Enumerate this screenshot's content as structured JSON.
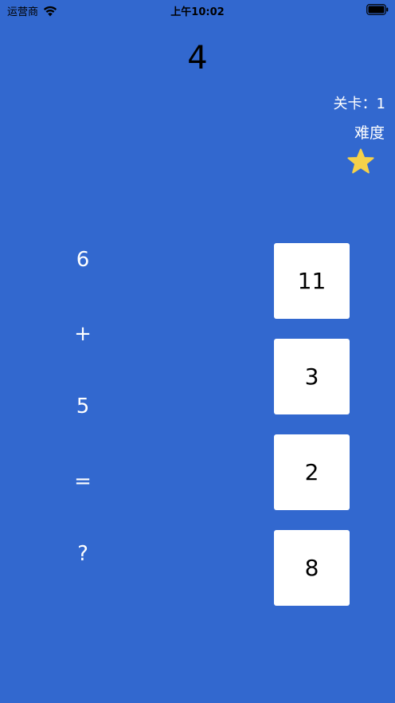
{
  "status_bar": {
    "carrier": "运营商",
    "time": "上午10:02"
  },
  "game": {
    "score": "4",
    "level_text": "关卡：1",
    "difficulty_label": "难度",
    "difficulty_stars": 1,
    "star_color": "#f5d14a",
    "equation": [
      "6",
      "+",
      "5",
      "=",
      "?"
    ],
    "answers": [
      "11",
      "3",
      "2",
      "8"
    ]
  },
  "colors": {
    "background": "#3268cf",
    "answer_button": "#ffffff"
  }
}
